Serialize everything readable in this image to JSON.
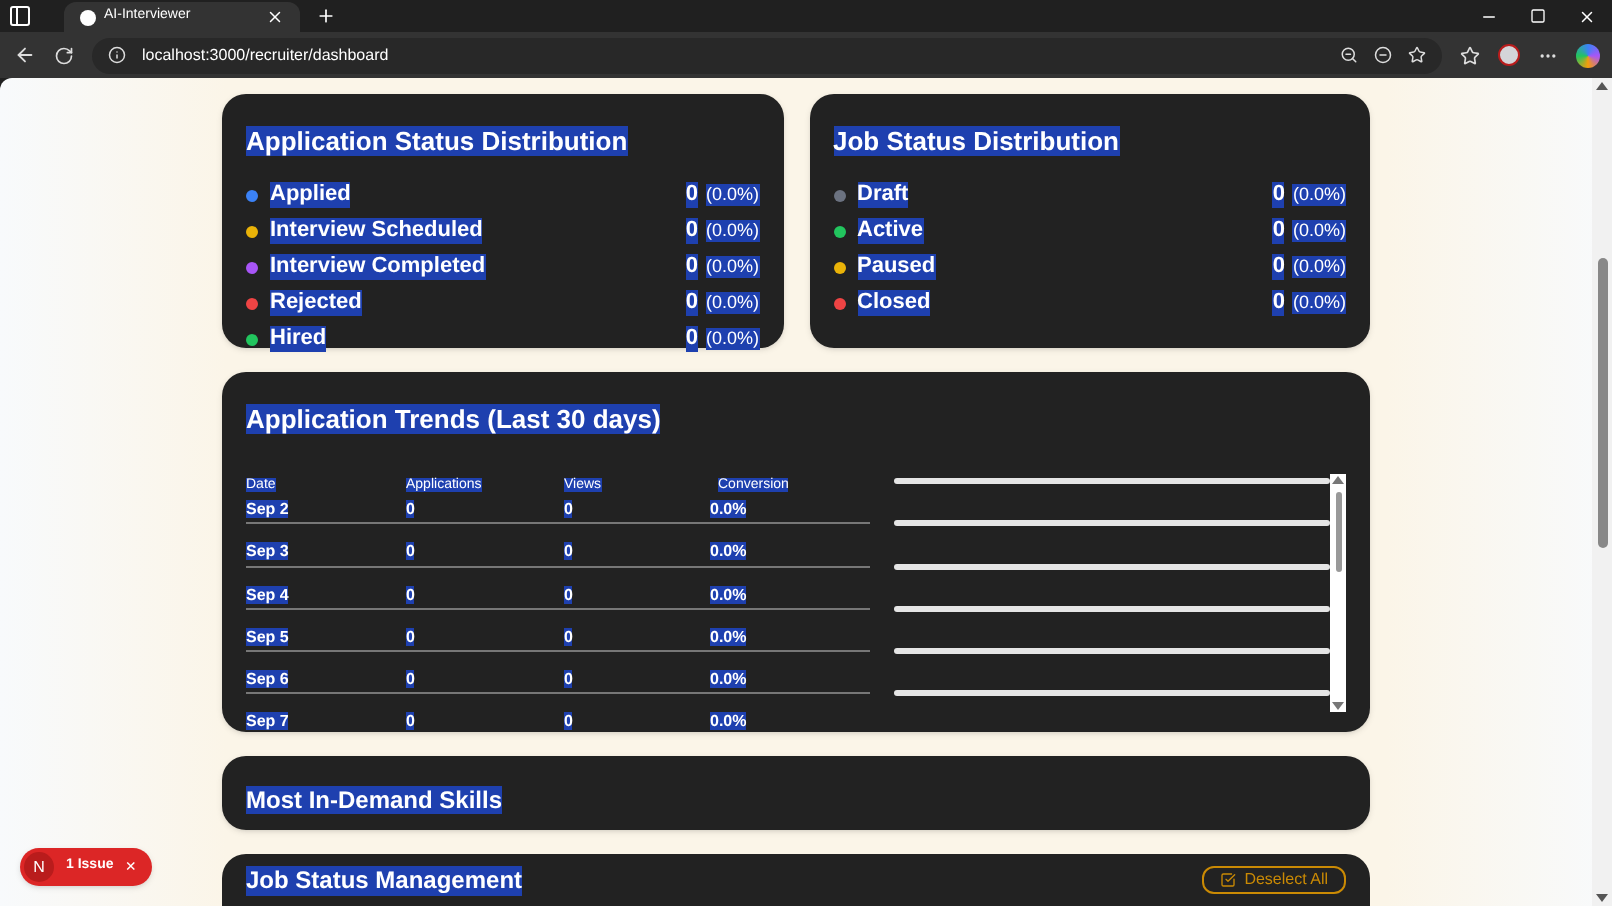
{
  "browser": {
    "tab_title": "AI-Interviewer",
    "url": "localhost:3000/recruiter/dashboard"
  },
  "application_status": {
    "title": "Application Status Distribution",
    "items": [
      {
        "label": "Applied",
        "count": "0",
        "percent": "(0.0%)",
        "color": "#3b82f6"
      },
      {
        "label": "Interview Scheduled",
        "count": "0",
        "percent": "(0.0%)",
        "color": "#eab308"
      },
      {
        "label": "Interview Completed",
        "count": "0",
        "percent": "(0.0%)",
        "color": "#a855f7"
      },
      {
        "label": "Rejected",
        "count": "0",
        "percent": "(0.0%)",
        "color": "#ef4444"
      },
      {
        "label": "Hired",
        "count": "0",
        "percent": "(0.0%)",
        "color": "#22c55e"
      }
    ]
  },
  "job_status": {
    "title": "Job Status Distribution",
    "items": [
      {
        "label": "Draft",
        "count": "0",
        "percent": "(0.0%)",
        "color": "#6b7280"
      },
      {
        "label": "Active",
        "count": "0",
        "percent": "(0.0%)",
        "color": "#22c55e"
      },
      {
        "label": "Paused",
        "count": "0",
        "percent": "(0.0%)",
        "color": "#eab308"
      },
      {
        "label": "Closed",
        "count": "0",
        "percent": "(0.0%)",
        "color": "#ef4444"
      }
    ]
  },
  "trends": {
    "title": "Application Trends (Last 30 days)",
    "columns": [
      "Date",
      "Applications",
      "Views",
      "Conversion"
    ],
    "rows": [
      {
        "date": "Sep 2",
        "applications": "0",
        "views": "0",
        "conversion": "0.0%"
      },
      {
        "date": "Sep 3",
        "applications": "0",
        "views": "0",
        "conversion": "0.0%"
      },
      {
        "date": "Sep 4",
        "applications": "0",
        "views": "0",
        "conversion": "0.0%"
      },
      {
        "date": "Sep 5",
        "applications": "0",
        "views": "0",
        "conversion": "0.0%"
      },
      {
        "date": "Sep 6",
        "applications": "0",
        "views": "0",
        "conversion": "0.0%"
      },
      {
        "date": "Sep 7",
        "applications": "0",
        "views": "0",
        "conversion": "0.0%"
      }
    ]
  },
  "skills": {
    "title": "Most In-Demand Skills"
  },
  "job_management": {
    "title": "Job Status Management",
    "button": "Deselect All"
  },
  "issue_badge": {
    "logo": "N",
    "label": "1 Issue",
    "close": "×"
  }
}
